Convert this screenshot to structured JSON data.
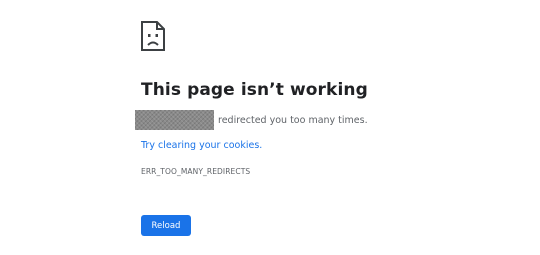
{
  "error": {
    "icon": "sad-document-icon",
    "title": "This page isn’t working",
    "redacted_host": "",
    "message": "redirected you too many times.",
    "suggestion_link": "Try clearing your cookies.",
    "code": "ERR_TOO_MANY_REDIRECTS",
    "reload_label": "Reload"
  },
  "colors": {
    "title": "#202124",
    "body_text": "#5f6368",
    "link": "#1a73e8",
    "button_bg": "#1a73e8",
    "button_text": "#ffffff",
    "redaction": "#8a8a8a"
  }
}
